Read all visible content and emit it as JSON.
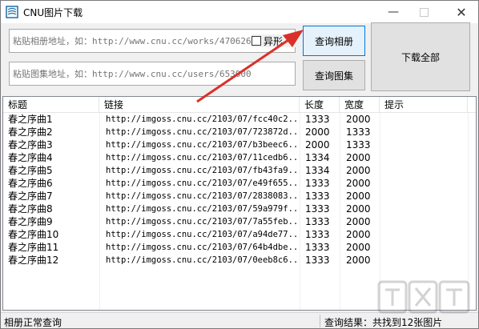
{
  "window": {
    "title": "CNU图片下载",
    "icon": "app-icon"
  },
  "inputs": {
    "album_url": {
      "placeholder": "粘贴相册地址，如：http://www.cnu.cc/works/470626"
    },
    "collection_url": {
      "placeholder": "粘贴图集地址，如：http://www.cnu.cc/users/653000"
    }
  },
  "checkbox": {
    "label": "异形",
    "checked": false
  },
  "buttons": {
    "query_album": "查询相册",
    "query_collection": "查询图集",
    "download_all": "下载全部"
  },
  "table": {
    "columns": [
      "标题",
      "链接",
      "长度",
      "宽度",
      "提示"
    ],
    "rows": [
      {
        "title": "春之序曲1",
        "link": "http://imgoss.cnu.cc/2103/07/fcc40c2...",
        "length": "1333",
        "width": "2000",
        "note": ""
      },
      {
        "title": "春之序曲2",
        "link": "http://imgoss.cnu.cc/2103/07/723872d...",
        "length": "2000",
        "width": "1333",
        "note": ""
      },
      {
        "title": "春之序曲3",
        "link": "http://imgoss.cnu.cc/2103/07/b3beec6...",
        "length": "2000",
        "width": "1333",
        "note": ""
      },
      {
        "title": "春之序曲4",
        "link": "http://imgoss.cnu.cc/2103/07/11cedb6...",
        "length": "1334",
        "width": "2000",
        "note": ""
      },
      {
        "title": "春之序曲5",
        "link": "http://imgoss.cnu.cc/2103/07/fb43fa9...",
        "length": "1334",
        "width": "2000",
        "note": ""
      },
      {
        "title": "春之序曲6",
        "link": "http://imgoss.cnu.cc/2103/07/e49f655...",
        "length": "1333",
        "width": "2000",
        "note": ""
      },
      {
        "title": "春之序曲7",
        "link": "http://imgoss.cnu.cc/2103/07/2838083...",
        "length": "1333",
        "width": "2000",
        "note": ""
      },
      {
        "title": "春之序曲8",
        "link": "http://imgoss.cnu.cc/2103/07/59a979f...",
        "length": "1333",
        "width": "2000",
        "note": ""
      },
      {
        "title": "春之序曲9",
        "link": "http://imgoss.cnu.cc/2103/07/7a55feb...",
        "length": "1333",
        "width": "2000",
        "note": ""
      },
      {
        "title": "春之序曲10",
        "link": "http://imgoss.cnu.cc/2103/07/a94de77...",
        "length": "1333",
        "width": "2000",
        "note": ""
      },
      {
        "title": "春之序曲11",
        "link": "http://imgoss.cnu.cc/2103/07/64b4dbe...",
        "length": "1333",
        "width": "2000",
        "note": ""
      },
      {
        "title": "春之序曲12",
        "link": "http://imgoss.cnu.cc/2103/07/0eeb8c6...",
        "length": "1333",
        "width": "2000",
        "note": ""
      }
    ]
  },
  "status": {
    "left": "相册正常查询",
    "right": "查询结果：共找到12张图片"
  },
  "colors": {
    "active_button_border": "#0078d7",
    "arrow": "#d9312a"
  }
}
